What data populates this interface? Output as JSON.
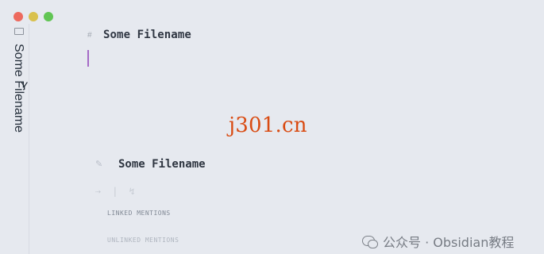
{
  "window": {
    "title": "Some Filename",
    "controls": [
      "close",
      "minimize",
      "maximize"
    ]
  },
  "sidebar": {
    "title": "Some Filename",
    "icons": [
      "checkbox-icon",
      "cursor-icon"
    ]
  },
  "editor": {
    "heading": "Some Filename",
    "heading_icon": "hash-icon"
  },
  "watermark": {
    "text": "j301.cn",
    "color": "#d94b12"
  },
  "backlinks": {
    "title": "Some Filename",
    "pencil_icon": "pencil-icon",
    "tools": [
      "⇢",
      "|",
      "↯"
    ],
    "linked_label": "LINKED MENTIONS",
    "unlinked_label": "UNLINKED MENTIONS"
  },
  "footer": {
    "credit": "公众号 · Obsidian教程",
    "icon": "wechat-icon"
  }
}
